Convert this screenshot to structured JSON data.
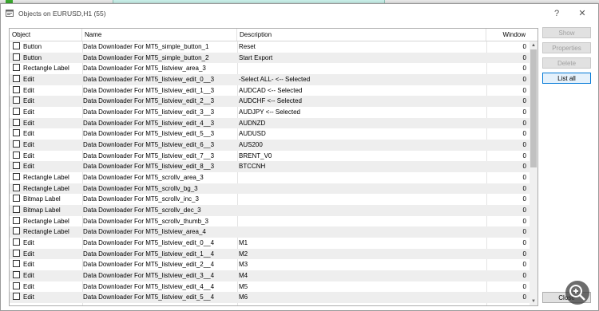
{
  "window": {
    "title": "Objects on EURUSD,H1 (55)",
    "help_glyph": "?",
    "close_glyph": "✕"
  },
  "columns": {
    "object": "Object",
    "name": "Name",
    "description": "Description",
    "window": "Window"
  },
  "rows": [
    {
      "object": "Button",
      "name": "Data Downloader For MT5_simple_button_1",
      "description": "Reset",
      "window": "0"
    },
    {
      "object": "Button",
      "name": "Data Downloader For MT5_simple_button_2",
      "description": "Start Export",
      "window": "0"
    },
    {
      "object": "Rectangle Label",
      "name": "Data Downloader For MT5_listview_area_3",
      "description": "",
      "window": "0"
    },
    {
      "object": "Edit",
      "name": "Data Downloader For MT5_listview_edit_0__3",
      "description": "-Select ALL-  <-- Selected",
      "window": "0"
    },
    {
      "object": "Edit",
      "name": "Data Downloader For MT5_listview_edit_1__3",
      "description": "AUDCAD  <-- Selected",
      "window": "0"
    },
    {
      "object": "Edit",
      "name": "Data Downloader For MT5_listview_edit_2__3",
      "description": "AUDCHF  <-- Selected",
      "window": "0"
    },
    {
      "object": "Edit",
      "name": "Data Downloader For MT5_listview_edit_3__3",
      "description": "AUDJPY  <-- Selected",
      "window": "0"
    },
    {
      "object": "Edit",
      "name": "Data Downloader For MT5_listview_edit_4__3",
      "description": "AUDNZD",
      "window": "0"
    },
    {
      "object": "Edit",
      "name": "Data Downloader For MT5_listview_edit_5__3",
      "description": "AUDUSD",
      "window": "0"
    },
    {
      "object": "Edit",
      "name": "Data Downloader For MT5_listview_edit_6__3",
      "description": "AUS200",
      "window": "0"
    },
    {
      "object": "Edit",
      "name": "Data Downloader For MT5_listview_edit_7__3",
      "description": "BRENT_V0",
      "window": "0"
    },
    {
      "object": "Edit",
      "name": "Data Downloader For MT5_listview_edit_8__3",
      "description": "BTCCNH",
      "window": "0"
    },
    {
      "object": "Rectangle Label",
      "name": "Data Downloader For MT5_scrollv_area_3",
      "description": "",
      "window": "0"
    },
    {
      "object": "Rectangle Label",
      "name": "Data Downloader For MT5_scrollv_bg_3",
      "description": "",
      "window": "0"
    },
    {
      "object": "Bitmap Label",
      "name": "Data Downloader For MT5_scrollv_inc_3",
      "description": "",
      "window": "0"
    },
    {
      "object": "Bitmap Label",
      "name": "Data Downloader For MT5_scrollv_dec_3",
      "description": "",
      "window": "0"
    },
    {
      "object": "Rectangle Label",
      "name": "Data Downloader For MT5_scrollv_thumb_3",
      "description": "",
      "window": "0"
    },
    {
      "object": "Rectangle Label",
      "name": "Data Downloader For MT5_listview_area_4",
      "description": "",
      "window": "0"
    },
    {
      "object": "Edit",
      "name": "Data Downloader For MT5_listview_edit_0__4",
      "description": "M1",
      "window": "0"
    },
    {
      "object": "Edit",
      "name": "Data Downloader For MT5_listview_edit_1__4",
      "description": "M2",
      "window": "0"
    },
    {
      "object": "Edit",
      "name": "Data Downloader For MT5_listview_edit_2__4",
      "description": "M3",
      "window": "0"
    },
    {
      "object": "Edit",
      "name": "Data Downloader For MT5_listview_edit_3__4",
      "description": "M4",
      "window": "0"
    },
    {
      "object": "Edit",
      "name": "Data Downloader For MT5_listview_edit_4__4",
      "description": "M5",
      "window": "0"
    },
    {
      "object": "Edit",
      "name": "Data Downloader For MT5_listview_edit_5__4",
      "description": "M6",
      "window": "0"
    }
  ],
  "buttons": {
    "show": "Show",
    "properties": "Properties",
    "delete": "Delete",
    "list_all": "List all",
    "close": "Close"
  },
  "colors": {
    "accent": "#0078d7",
    "row_alt": "#eeeeee",
    "disabled_text": "#a0a0a0"
  }
}
